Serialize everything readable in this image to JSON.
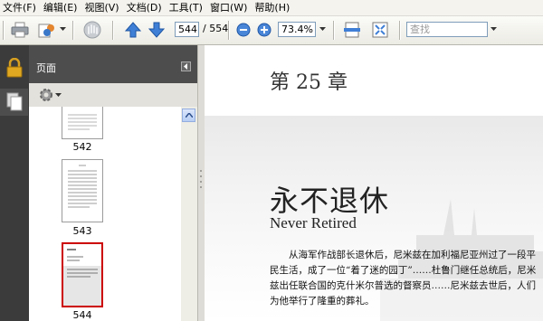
{
  "menu": {
    "items": [
      "文件(F)",
      "编辑(E)",
      "视图(V)",
      "文档(D)",
      "工具(T)",
      "窗口(W)",
      "帮助(H)"
    ]
  },
  "toolbar": {
    "page_current": "544",
    "page_total": "/ 554",
    "zoom": "73.4%",
    "search_placeholder": "查找"
  },
  "panel": {
    "title": "页面"
  },
  "thumbnails": [
    {
      "label": "542"
    },
    {
      "label": "543"
    },
    {
      "label": "544",
      "selected": true
    }
  ],
  "document": {
    "chapter": "第 25 章",
    "title": "永不退休",
    "subtitle": "Never Retired",
    "paragraph": "从海军作战部长退休后，尼米兹在加利福尼亚州过了一段平民生活，成了一位“着了迷的园丁”……杜鲁门继任总统后，尼米兹出任联合国的克什米尔普选的督察员……尼米兹去世后，人们为他举行了隆重的葬礼。"
  },
  "colors": {
    "selection": "#cc0000",
    "dark_panel": "#3b3b3b",
    "accent_blue": "#2a6fd6"
  }
}
